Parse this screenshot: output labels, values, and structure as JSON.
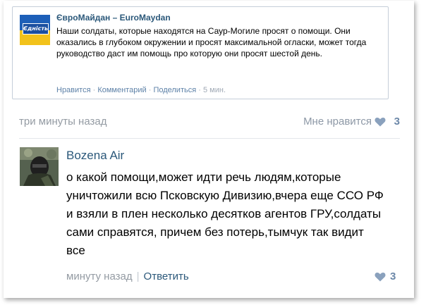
{
  "embed": {
    "title": "ЄвроМайдан – EuroMaydan",
    "avatar_label": "Єдність",
    "text": "Наши солдаты, которые находятся на Саур-Могиле просят о помощи. Они оказались в глубоком окружении и просят максимальной огласки, может тогда руководство даст им помощь про которую они просят шестой день.",
    "actions": {
      "like": "Нравится",
      "comment": "Комментарий",
      "share": "Поделиться",
      "time": "5 мин.",
      "dot": "·"
    }
  },
  "post_meta": {
    "time": "три минуты назад",
    "like_label": "Мне нравится",
    "like_count": "3"
  },
  "comment": {
    "author": "Bozena Air",
    "text": "о какой помощи,может идти речь людям,которые уничтожили всю Псковскую Дивизию,вчера еще ССО РФ и взяли в плен несколько десятков агентов ГРУ,солдаты сами справятся, причем без потерь,тымчук так видит все",
    "time": "минуту назад",
    "separator": "|",
    "reply_label": "Ответить",
    "like_count": "3"
  },
  "colors": {
    "link": "#2b587a",
    "muted": "#949ba3",
    "heart": "#6b87a8"
  }
}
